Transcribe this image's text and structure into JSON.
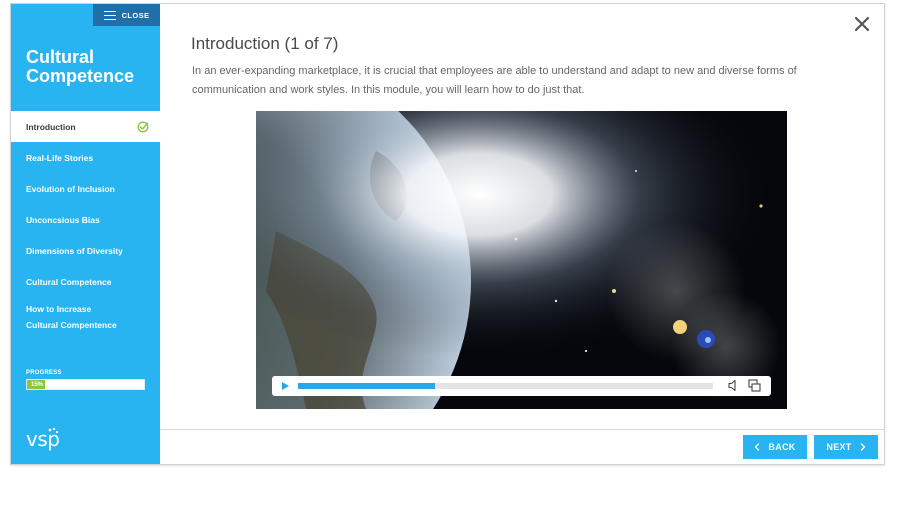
{
  "sidebar": {
    "close_label": "CLOSE",
    "course_title": "Cultural Competence",
    "items": [
      {
        "label": "Introduction"
      },
      {
        "label": "Real-Life Stories"
      },
      {
        "label": "Evolution of Inclusion"
      },
      {
        "label": "Unconcsious Bias"
      },
      {
        "label": "Dimensions of Diversity"
      },
      {
        "label": "Cultural Competence"
      },
      {
        "label_line1": "How to Increase",
        "label_line2": "Cultural Compentence"
      }
    ],
    "progress": {
      "label": "PROGRESS",
      "value_text": "15%",
      "value": 0.15
    },
    "logo_text": "vsp"
  },
  "main": {
    "title": "Introduction (1 of 7)",
    "intro": "In an ever-expanding marketplace, it is crucial that employees are able to understand and adapt to new and diverse forms of communication and work styles. In this module, you will learn how to do just that.",
    "video": {
      "played_fraction": 0.33
    },
    "back_label": "BACK",
    "next_label": "NEXT"
  },
  "colors": {
    "sidebar_bg": "#27b4f0",
    "close_bg": "#1f6fa8",
    "progress_fill": "#8cc63f",
    "scrub_fill": "#27a6e8",
    "check": "#8cc63f"
  },
  "icons": [
    "hamburger-icon",
    "check-icon",
    "close-icon",
    "play-icon",
    "volume-icon",
    "fullscreen-icon",
    "chevron-left-icon",
    "chevron-right-icon"
  ]
}
